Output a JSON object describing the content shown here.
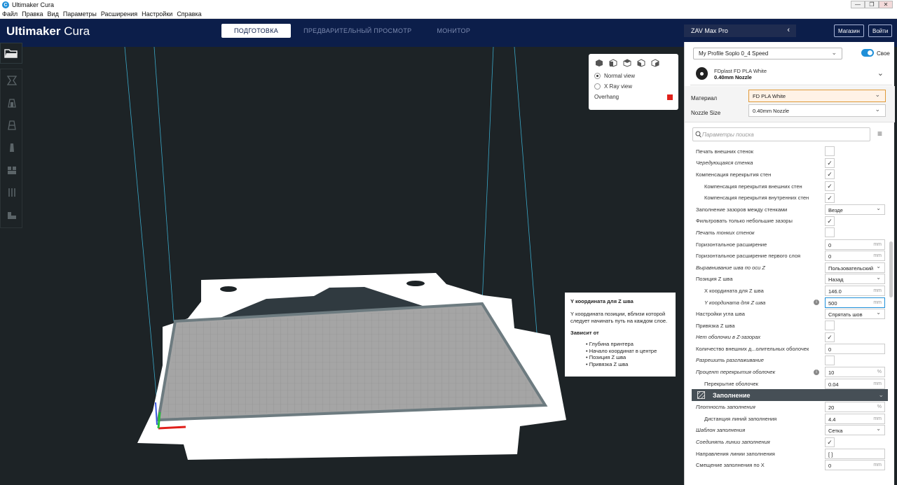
{
  "titlebar": {
    "title": "Ultimaker Cura",
    "app_icon": "cura-icon",
    "buttons": [
      "—",
      "❐",
      "✕"
    ]
  },
  "menubar": {
    "items": [
      "Файл",
      "Правка",
      "Вид",
      "Параметры",
      "Расширения",
      "Настройки",
      "Справка"
    ]
  },
  "header": {
    "logo_bold": "Ultimaker",
    "logo_light": " Cura",
    "tabs": [
      "ПОДГОТОВКА",
      "ПРЕДВАРИТЕЛЬНЫЙ ПРОСМОТР",
      "МОНИТОР"
    ],
    "printer": "ZAV Max Pro",
    "marketplace": "Магазин",
    "signin": "Войти"
  },
  "view_panel": {
    "normal_view": "Normal view",
    "xray_view": "X Ray view",
    "overhang": "Overhang",
    "overhang_color": "#e0201b"
  },
  "tooltip": {
    "title": "Y координата для Z шва",
    "description": "Y координата позиции, вблизи которой следует начинать путь на каждом слое.",
    "depends_title": "Зависит от",
    "depends": [
      "• Глубина принтера",
      "• Начало координат в центре",
      "• Позиция Z шва",
      "• Привязка Z шва"
    ]
  },
  "sidebar": {
    "profile": "My Profile Soplo 0_4 Speed",
    "custom_label": "Своe",
    "material_name": "FDplast FD PLA White",
    "nozzle_name": "0.40mm Nozzle",
    "material_label": "Материал",
    "material_value": "FD PLA White",
    "nozzle_label": "Nozzle Size",
    "nozzle_value": "0.40mm Nozzle",
    "search_placeholder": "Параметры поиска",
    "category_label": "Заполнение",
    "rows": [
      {
        "label": "Печать внешних стенок",
        "type": "check",
        "value": ""
      },
      {
        "label": "Чередующаяся стенка",
        "type": "check",
        "value": "✓",
        "italic": true
      },
      {
        "label": "Компенсация перекрытия стен",
        "type": "check",
        "value": "✓"
      },
      {
        "label": "Компенсация перекрытия внешних стен",
        "type": "check",
        "value": "✓",
        "indent": true
      },
      {
        "label": "Компенсация перекрытия внутренних стен",
        "type": "check",
        "value": "✓",
        "indent": true
      },
      {
        "label": "Заполнение зазоров между стенками",
        "type": "select",
        "value": "Везде"
      },
      {
        "label": "Фильтровать только небольшие зазоры",
        "type": "check",
        "value": "✓"
      },
      {
        "label": "Печать тонких стенок",
        "type": "check",
        "value": "",
        "italic": true
      },
      {
        "label": "Горизонтальное расширение",
        "type": "input",
        "value": "0",
        "unit": "mm"
      },
      {
        "label": "Горизонтальное расширение первого слоя",
        "type": "input",
        "value": "0",
        "unit": "mm"
      },
      {
        "label": "Выравнивание шва по оси Z",
        "type": "select",
        "value": "Пользовательский",
        "italic": true
      },
      {
        "label": "Позиция Z шва",
        "type": "select",
        "value": "Назад"
      },
      {
        "label": "X координата для Z шва",
        "type": "input",
        "value": "146.0",
        "unit": "mm",
        "indent": true
      },
      {
        "label": "Y координата для Z шва",
        "type": "input",
        "value": "500",
        "unit": "mm",
        "indent": true,
        "italic": true,
        "info": true,
        "highlight": true
      },
      {
        "label": "Настройки угла шва",
        "type": "select",
        "value": "Спрятать шов"
      },
      {
        "label": "Привязка Z шва",
        "type": "check",
        "value": ""
      },
      {
        "label": "Нет оболочки в Z-зазорах",
        "type": "check",
        "value": "✓",
        "italic": true
      },
      {
        "label": "Количество внешних д...олительных оболочек",
        "type": "input",
        "value": "0",
        "unit": ""
      },
      {
        "label": "Разрешить разглаживание",
        "type": "check",
        "value": "",
        "italic": true
      },
      {
        "label": "Процент перекрытия оболочек",
        "type": "input",
        "value": "10",
        "unit": "%",
        "italic": true,
        "info": true
      },
      {
        "label": "Перекрытие оболочек",
        "type": "input",
        "value": "0.04",
        "unit": "mm",
        "indent": true
      }
    ],
    "rows2": [
      {
        "label": "Плотность заполнения",
        "type": "input",
        "value": "20",
        "unit": "%",
        "italic": true
      },
      {
        "label": "Дистанция линий заполнения",
        "type": "input",
        "value": "4.4",
        "unit": "mm",
        "indent": true
      },
      {
        "label": "Шаблон заполнения",
        "type": "select",
        "value": "Сетка",
        "italic": true
      },
      {
        "label": "Соединять линии заполнения",
        "type": "check",
        "value": "✓",
        "italic": true
      },
      {
        "label": "Направления линии заполнения",
        "type": "input",
        "value": "[ ]",
        "unit": ""
      },
      {
        "label": "Смещение заполнения по X",
        "type": "input",
        "value": "0",
        "unit": "mm"
      }
    ]
  }
}
